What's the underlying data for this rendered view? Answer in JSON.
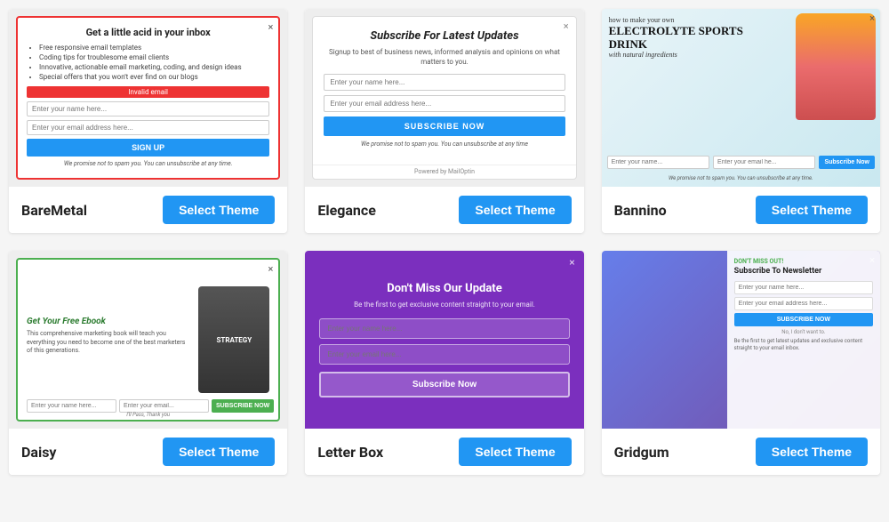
{
  "themes": [
    {
      "id": "baremetal",
      "name": "BareMetal",
      "select_label": "Select Theme",
      "preview": {
        "close": "×",
        "title": "Get a little acid in your inbox",
        "bullets": [
          "Free responsive email templates",
          "Coding tips for troublesome email clients",
          "Innovative, actionable email marketing, coding, and design ideas",
          "Special offers that you won't ever find on our blogs"
        ],
        "invalid_label": "Invalid email",
        "name_placeholder": "Enter your name here...",
        "email_placeholder": "Enter your email address here...",
        "btn_label": "SIGN UP",
        "note": "We promise not to spam you. You can unsubscribe at any time."
      }
    },
    {
      "id": "elegance",
      "name": "Elegance",
      "select_label": "Select Theme",
      "preview": {
        "close": "×",
        "title": "Subscribe For Latest Updates",
        "subtitle": "Signup to best of business news, informed analysis and opinions on what matters to you.",
        "name_placeholder": "Enter your name here...",
        "email_placeholder": "Enter your email address here...",
        "btn_label": "SUBSCRIBE NOW",
        "note": "We promise not to spam you. You can unsubscribe at any time",
        "powered": "Powered by MailOptin"
      }
    },
    {
      "id": "bannino",
      "name": "Bannino",
      "select_label": "Select Theme",
      "preview": {
        "close": "×",
        "small_text": "how to make your own",
        "big_text": "ELECTROLYTE SPORTS DRINK",
        "with_text": "with natural ingredients",
        "name_placeholder": "Enter your name...",
        "email_placeholder": "Enter your email he...",
        "btn_label": "Subscribe Now",
        "note": "We promise not to spam you. You can unsubscribe at any time."
      }
    },
    {
      "id": "daisy",
      "name": "Daisy",
      "select_label": "Select Theme",
      "preview": {
        "close": "×",
        "title": "Get Your Free Ebook",
        "desc": "This comprehensive marketing book will teach you everything you need to become one of the best marketers of this generations.",
        "book_title": "STRATEGY",
        "name_placeholder": "Enter your name here...",
        "email_placeholder": "Enter your email...",
        "btn_label": "SUBSCRIBE NOW",
        "thankyou": "I'll Pass, Thank you"
      }
    },
    {
      "id": "letterbox",
      "name": "Letter Box",
      "select_label": "Select Theme",
      "preview": {
        "close": "×",
        "title": "Don't Miss Our Update",
        "subtitle": "Be the first to get exclusive content straight to your email.",
        "name_placeholder": "Enter your name here...",
        "email_placeholder": "Enter your email here...",
        "btn_label": "Subscribe Now"
      }
    },
    {
      "id": "gridgum",
      "name": "Gridgum",
      "select_label": "Select Theme",
      "preview": {
        "close": "×",
        "dont_miss": "DON'T MISS OUT!",
        "title": "Subscribe To Newsletter",
        "name_placeholder": "Enter your name here...",
        "email_placeholder": "Enter your email address here...",
        "btn_label": "SUBSCRIBE NOW",
        "no_thanks": "No, I don't want to.",
        "bottom_text": "Be the first to get latest updates and exclusive content straight to your email inbox."
      }
    }
  ]
}
